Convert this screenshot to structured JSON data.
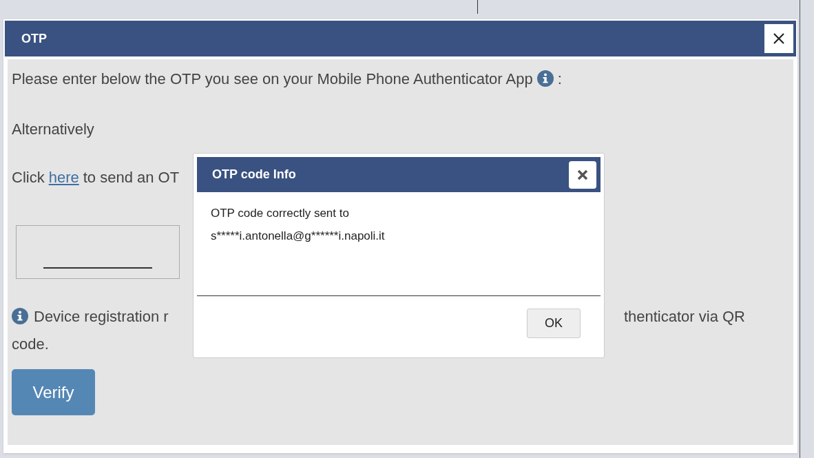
{
  "main_dialog": {
    "title": "OTP",
    "instruction": "Please enter below the OTP you see on your Mobile Phone Authenticator App",
    "instruction_suffix": ":",
    "alternative_label": "Alternatively",
    "send_line": {
      "prefix": "Click",
      "link": "here",
      "suffix": "to send an OT"
    },
    "device_note": {
      "start": "Device registration r",
      "end": "thenticator via QR",
      "wrap": "code."
    },
    "verify_button": "Verify"
  },
  "info_dialog": {
    "title": "OTP code Info",
    "message": "OTP code correctly sent to",
    "email": "s*****i.antonella@g******i.napoli.it",
    "ok_button": "OK"
  }
}
